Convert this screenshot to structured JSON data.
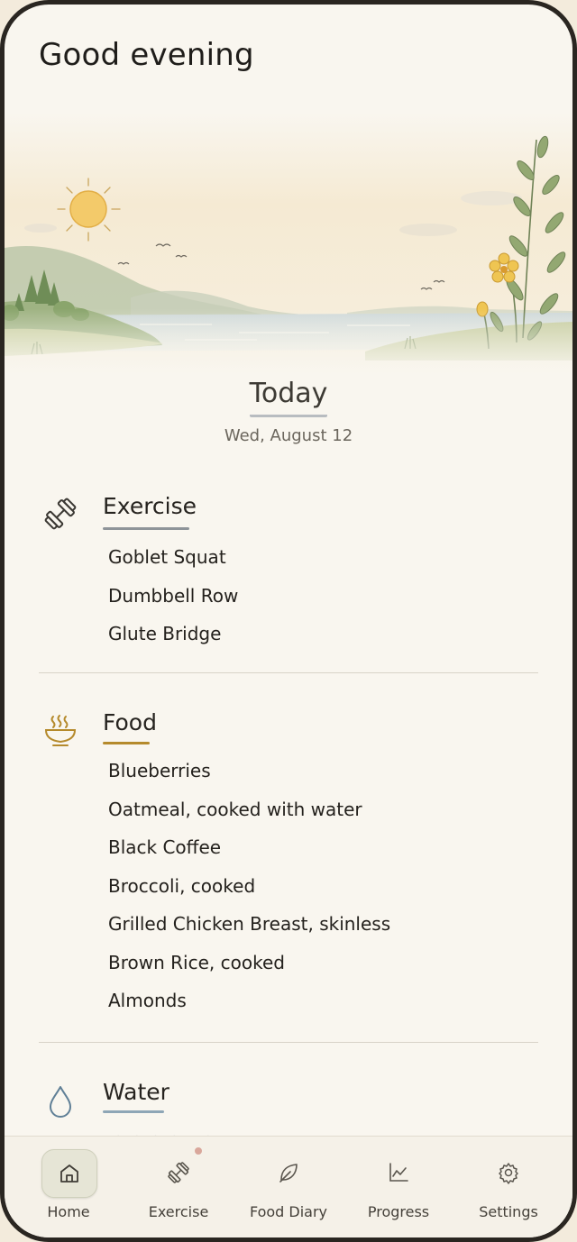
{
  "greeting": "Good evening",
  "today": {
    "title": "Today",
    "date": "Wed, August 12"
  },
  "exercise": {
    "title": "Exercise",
    "icon": "dumbbell-icon",
    "items": [
      "Goblet Squat",
      "Dumbbell Row",
      "Glute Bridge"
    ]
  },
  "food": {
    "title": "Food",
    "icon": "bowl-icon",
    "items": [
      "Blueberries",
      "Oatmeal, cooked with water",
      "Black Coffee",
      "Broccoli, cooked",
      "Grilled Chicken Breast, skinless",
      "Brown Rice, cooked",
      "Almonds"
    ]
  },
  "water": {
    "title": "Water",
    "icon": "water-drop-icon"
  },
  "tabs": [
    {
      "label": "Home",
      "icon": "home-icon",
      "active": true
    },
    {
      "label": "Exercise",
      "icon": "dumbbell-icon",
      "active": false,
      "badge": true
    },
    {
      "label": "Food Diary",
      "icon": "leaf-icon",
      "active": false
    },
    {
      "label": "Progress",
      "icon": "chart-icon",
      "active": false
    },
    {
      "label": "Settings",
      "icon": "gear-icon",
      "active": false
    }
  ],
  "colors": {
    "background": "#f9f6ef",
    "frame": "#2a2621",
    "exercise_underline": "#8e9499",
    "food_accent": "#b58a2c",
    "water_accent": "#5f7f96",
    "active_tab": "#e6e5d6"
  }
}
